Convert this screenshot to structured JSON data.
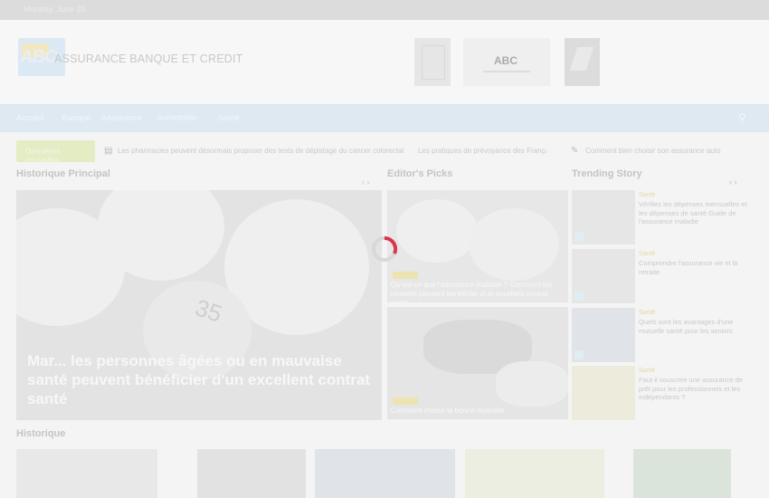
{
  "topbar": {
    "date": "Monday, June 20"
  },
  "header": {
    "logo_text": "ABC",
    "site_name": "ASSURANCE BANQUE ET CREDIT",
    "ad_label": "ABC"
  },
  "nav": {
    "items": [
      "Accueil",
      "Banque",
      "Assurance",
      "Immobilier",
      "Santé"
    ],
    "search_icon": "search-icon"
  },
  "ticker": {
    "badge": "Dernières nouvelles",
    "items": [
      "Les pharmacies peuvent désormais proposer des tests de dépistage du cancer colorectal",
      "Les pratiques de prévoyance des Français",
      "Comment bien choisir son assurance auto"
    ]
  },
  "sections": {
    "main": "Historique Principal",
    "picks": "Editor's Picks",
    "trending": "Trending Story",
    "history": "Historique"
  },
  "hero": {
    "title": "Mar... les personnes âgées ou en mauvaise santé peuvent bénéficier d'un excellent contrat santé",
    "number": "35"
  },
  "picks": [
    {
      "category": "Santé",
      "caption": "Qu'est-ce que l'assurance maladie ? Comment les retraités peuvent bénéficier d'un excellent contrat santé"
    },
    {
      "category": "Santé",
      "caption": "Comment choisir la bonne mutuelle"
    }
  ],
  "trending": [
    {
      "category": "Santé",
      "title": "Vérifiez les dépenses mensuelles et les dépenses de santé Guide de l'assurance maladie"
    },
    {
      "category": "Santé",
      "title": "Comprendre l'assurance vie et la retraite"
    },
    {
      "category": "Santé",
      "title": "Quels sont les avantages d'une mutuelle santé pour les seniors"
    },
    {
      "category": "Santé",
      "title": "Faut-il souscrire une assurance de prêt pour les professionnels et les indépendants ?"
    }
  ],
  "colors": {
    "accent": "#d9364a",
    "nav_bg": "#dfe9f1"
  }
}
